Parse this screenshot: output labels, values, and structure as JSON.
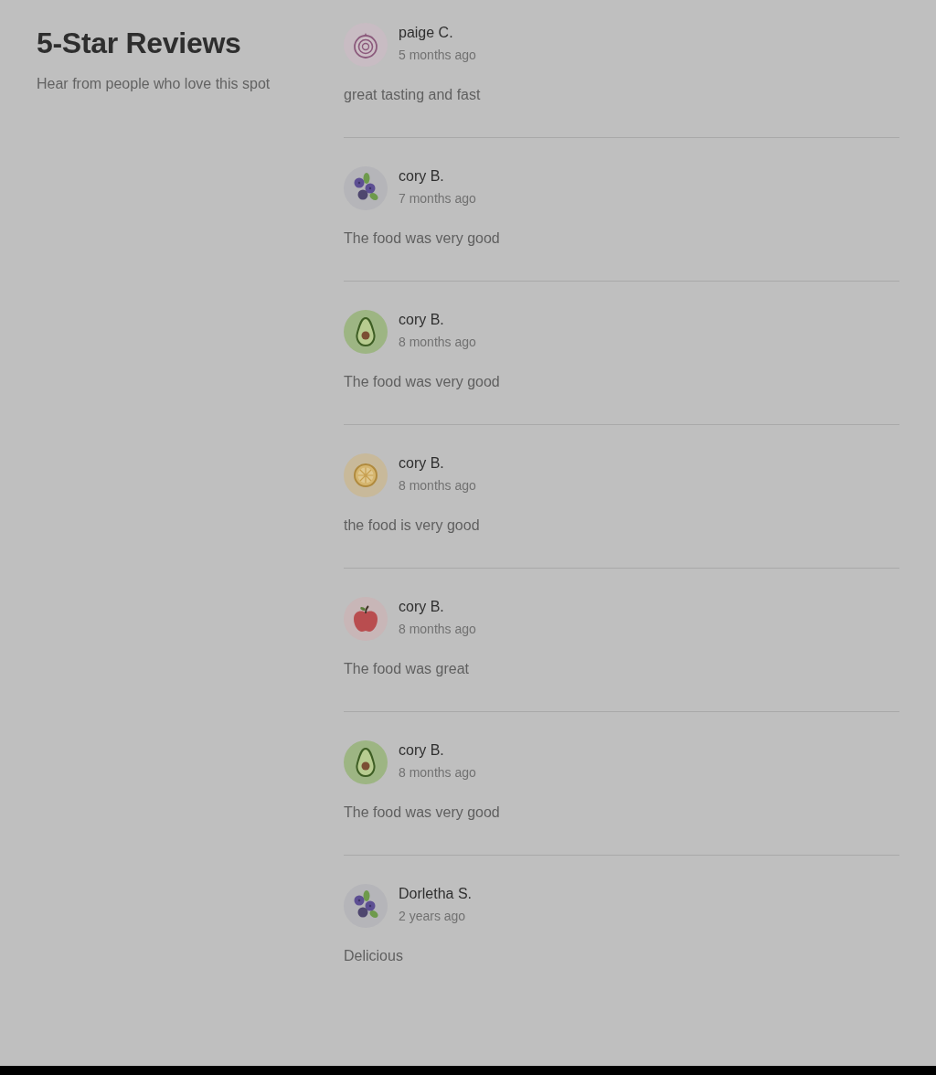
{
  "header": {
    "title": "5-Star Reviews",
    "subtitle": "Hear from people who love this spot"
  },
  "reviews": [
    {
      "avatar": {
        "kind": "onion"
      },
      "name": "paige C.",
      "time": "5 months ago",
      "text": "great tasting and fast"
    },
    {
      "avatar": {
        "kind": "blueberries"
      },
      "name": "cory B.",
      "time": "7 months ago",
      "text": "The food was very good"
    },
    {
      "avatar": {
        "kind": "avocado"
      },
      "name": "cory B.",
      "time": "8 months ago",
      "text": "The food was very good"
    },
    {
      "avatar": {
        "kind": "lemon"
      },
      "name": "cory B.",
      "time": "8 months ago",
      "text": "the food is very good"
    },
    {
      "avatar": {
        "kind": "apple"
      },
      "name": "cory B.",
      "time": "8 months ago",
      "text": "The food was great"
    },
    {
      "avatar": {
        "kind": "avocado"
      },
      "name": "cory B.",
      "time": "8 months ago",
      "text": "The food was very good"
    },
    {
      "avatar": {
        "kind": "blueberries"
      },
      "name": "Dorletha S.",
      "time": "2 years ago",
      "text": "Delicious"
    }
  ]
}
